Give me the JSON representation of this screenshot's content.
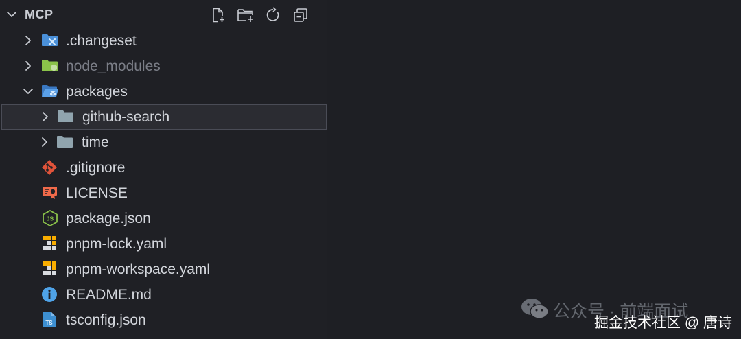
{
  "explorer": {
    "title": "MCP",
    "actions": [
      {
        "name": "new-file",
        "icon": "new-file-icon"
      },
      {
        "name": "new-folder",
        "icon": "new-folder-icon"
      },
      {
        "name": "refresh",
        "icon": "refresh-icon"
      },
      {
        "name": "collapse-all",
        "icon": "collapse-all-icon"
      }
    ],
    "tree": [
      {
        "label": ".changeset",
        "type": "folder",
        "icon": "changeset-folder-icon",
        "expanded": false,
        "depth": 0
      },
      {
        "label": "node_modules",
        "type": "folder",
        "icon": "node-modules-folder-icon",
        "expanded": false,
        "depth": 0,
        "dimmed": true
      },
      {
        "label": "packages",
        "type": "folder",
        "icon": "packages-folder-icon",
        "expanded": true,
        "depth": 0
      },
      {
        "label": "github-search",
        "type": "folder",
        "icon": "folder-icon",
        "expanded": false,
        "depth": 1,
        "selected": true
      },
      {
        "label": "time",
        "type": "folder",
        "icon": "folder-icon",
        "expanded": false,
        "depth": 1
      },
      {
        "label": ".gitignore",
        "type": "file",
        "icon": "git-icon",
        "depth": 0
      },
      {
        "label": "LICENSE",
        "type": "file",
        "icon": "license-icon",
        "depth": 0
      },
      {
        "label": "package.json",
        "type": "file",
        "icon": "nodejs-icon",
        "depth": 0
      },
      {
        "label": "pnpm-lock.yaml",
        "type": "file",
        "icon": "pnpm-icon",
        "depth": 0
      },
      {
        "label": "pnpm-workspace.yaml",
        "type": "file",
        "icon": "pnpm-icon",
        "depth": 0
      },
      {
        "label": "README.md",
        "type": "file",
        "icon": "info-icon",
        "depth": 0
      },
      {
        "label": "tsconfig.json",
        "type": "file",
        "icon": "tsconfig-icon",
        "depth": 0
      }
    ]
  },
  "watermark": {
    "line1": "公众号 · 前端面试",
    "line2": "掘金技术社区 @ 唐诗"
  },
  "colors": {
    "background": "#1e1f24",
    "text": "#d3d6dc",
    "dimmed_text": "#7b7e87",
    "selection_border": "#4a4c56",
    "folder_gray": "#90a4ae",
    "changeset_blue": "#4a90d9",
    "node_green": "#8bc34a",
    "git_orange": "#e0533a",
    "pnpm_yellow": "#f9ad00",
    "info_blue": "#4fa3e8",
    "ts_blue": "#3d8fd1"
  }
}
